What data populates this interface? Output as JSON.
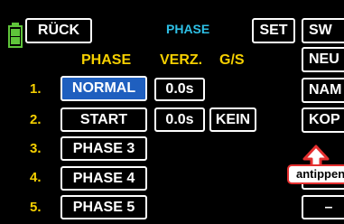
{
  "header": {
    "back_label": "RÜCK",
    "title": "PHASE",
    "set_label": "SET",
    "sw_label": "SW"
  },
  "columns": {
    "phase": "PHASE",
    "delay": "VERZ.",
    "gs": "G/S"
  },
  "rows": [
    {
      "number": "1.",
      "name": "NORMAL",
      "delay": "0.0s",
      "gs": ""
    },
    {
      "number": "2.",
      "name": "START",
      "delay": "0.0s",
      "gs": "KEIN"
    },
    {
      "number": "3.",
      "name": "PHASE 3",
      "delay": "",
      "gs": ""
    },
    {
      "number": "4.",
      "name": "PHASE 4",
      "delay": "",
      "gs": ""
    },
    {
      "number": "5.",
      "name": "PHASE 5",
      "delay": "",
      "gs": ""
    }
  ],
  "side_buttons": {
    "new": "NEU",
    "name": "NAM",
    "copy": "KOP",
    "minus": "–"
  },
  "callout": {
    "text": "antippen"
  },
  "colors": {
    "background": "#000000",
    "accent_yellow": "#f6d000",
    "accent_cyan": "#2ec0e6",
    "selected_blue": "#1f5fbf",
    "battery_green": "#5fc43a",
    "callout_red": "#e53030"
  }
}
